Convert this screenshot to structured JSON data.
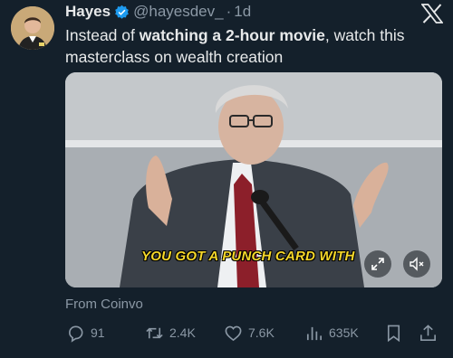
{
  "author": {
    "name": "Hayes",
    "handle": "@hayesdev_",
    "separator": "·",
    "time": "1d"
  },
  "post": {
    "text_before": "Instead of ",
    "text_bold": "watching a 2-hour movie",
    "text_after": ", watch this masterclass on wealth creation"
  },
  "media": {
    "caption": "YOU GOT A PUNCH CARD WITH",
    "expand_icon": "expand-icon",
    "mute_icon": "speaker-muted-icon"
  },
  "source": "From Coinvo",
  "actions": {
    "replies": "91",
    "reposts": "2.4K",
    "likes": "7.6K",
    "views": "635K"
  },
  "colors": {
    "background": "#14202b",
    "text_primary": "#e7e9ea",
    "text_secondary": "#8b98a5",
    "verified": "#1d9bf0",
    "caption": "#f5d72a"
  }
}
